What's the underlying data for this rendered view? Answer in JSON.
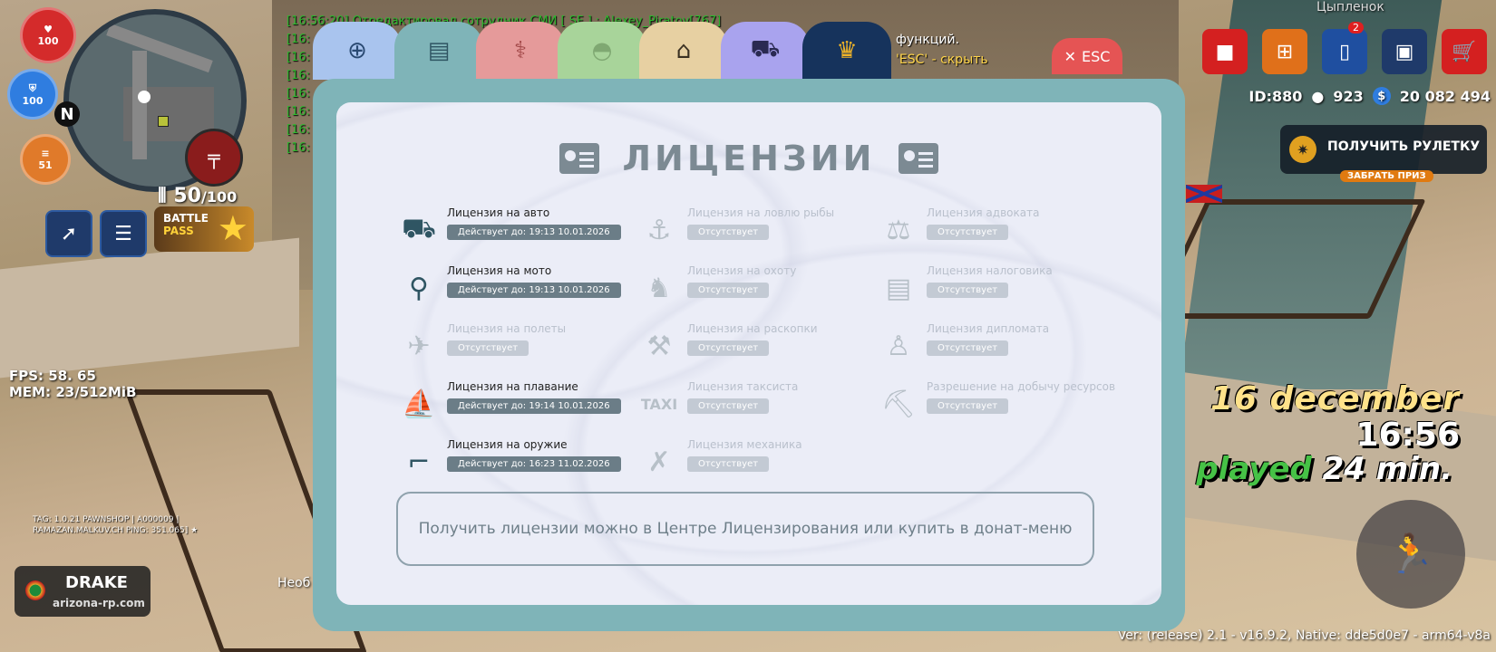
{
  "hud": {
    "hp": "100",
    "armor": "100",
    "hunger": "51",
    "north": "N",
    "ammo_current": "50",
    "ammo_max": "/100",
    "battle_pass_line1": "BATTLE",
    "battle_pass_line2": "PASS",
    "fps_line": "FPS:  58. 65",
    "mem_line": "MEM: 23/512MiB",
    "tag_line1": "TAG: 1.0.21 PAWNSHOP | A000009 |",
    "tag_line2": "RAMAZAN.MALKUV.CH    PING: 351.065] ★",
    "server_name": "DRAKE",
    "server_site": "arizona-rp.com",
    "bottom_left_text": "Необ"
  },
  "chat": {
    "line1": "[16:56:20] Отредактировал сотрудник СМИ [ SF ] : Alexey_Piratov[767]",
    "prefixes": [
      "[16:",
      "[16:",
      "[16:",
      "[16:",
      "[16:",
      "[16:",
      "[16:"
    ],
    "hint_line": "функций.",
    "hint_esc": "'ESC' - скрыть"
  },
  "top_right": {
    "nick": "Цыпленок",
    "phone_badge": "2",
    "id_label": "ID:880",
    "online": "923",
    "money": "20 082 494",
    "roulette_label": "ПОЛУЧИТЬ РУЛЕТКУ",
    "roulette_prize": "ЗАБРАТЬ ПРИЗ"
  },
  "overlay": {
    "date": "16 december",
    "time": "16:56",
    "played_word": "played",
    "played_value": "24 min.",
    "version": "Ver: (release) 2.1 - v16.9.2, Native: dde5d0e7 - arm64-v8a"
  },
  "dialog": {
    "esc_label": "ESC",
    "title": "ЛИЦЕНЗИИ",
    "tabs": [
      {
        "icon": "passport-icon",
        "color": "#a9c4ee"
      },
      {
        "icon": "id-card-icon",
        "color": "#7fb4b8"
      },
      {
        "icon": "medicine-icon",
        "color": "#e59a9a"
      },
      {
        "icon": "helmet-icon",
        "color": "#a8d49a"
      },
      {
        "icon": "houses-icon",
        "color": "#e7d0a2"
      },
      {
        "icon": "car-icon",
        "color": "#a9a3ee"
      },
      {
        "icon": "crown-icon",
        "color": "#16335c"
      }
    ],
    "licenses": [
      {
        "name": "Лицензия на авто",
        "status": "Действует до: 19:13 10.01.2026",
        "icon": "car-icon",
        "active": true
      },
      {
        "name": "Лицензия на мото",
        "status": "Действует до: 19:13 10.01.2026",
        "icon": "motorcycle-icon",
        "active": true
      },
      {
        "name": "Лицензия на полеты",
        "status": "Отсутствует",
        "icon": "airplane-icon",
        "active": false
      },
      {
        "name": "Лицензия на плавание",
        "status": "Действует до: 19:14 10.01.2026",
        "icon": "sailboat-icon",
        "active": true
      },
      {
        "name": "Лицензия на оружие",
        "status": "Действует до: 16:23 11.02.2026",
        "icon": "pistol-icon",
        "active": true
      },
      {
        "name": "Лицензия на ловлю рыбы",
        "status": "Отсутствует",
        "icon": "fishing-icon",
        "active": false
      },
      {
        "name": "Лицензия на охоту",
        "status": "Отсутствует",
        "icon": "deer-icon",
        "active": false
      },
      {
        "name": "Лицензия на раскопки",
        "status": "Отсутствует",
        "icon": "shovel-icon",
        "active": false
      },
      {
        "name": "Лицензия таксиста",
        "status": "Отсутствует",
        "icon": "taxi-icon",
        "active": false
      },
      {
        "name": "Лицензия механика",
        "status": "Отсутствует",
        "icon": "tools-icon",
        "active": false
      },
      {
        "name": "Лицензия адвоката",
        "status": "Отсутствует",
        "icon": "gavel-icon",
        "active": false
      },
      {
        "name": "Лицензия налоговика",
        "status": "Отсутствует",
        "icon": "document-icon",
        "active": false
      },
      {
        "name": "Лицензия дипломата",
        "status": "Отсутствует",
        "icon": "podium-icon",
        "active": false
      },
      {
        "name": "Разрешение на добычу ресурсов",
        "status": "Отсутствует",
        "icon": "pickaxe-icon",
        "active": false
      }
    ],
    "note": "Получить лицензии можно в Центре Лицензирования или купить в донат-меню"
  }
}
